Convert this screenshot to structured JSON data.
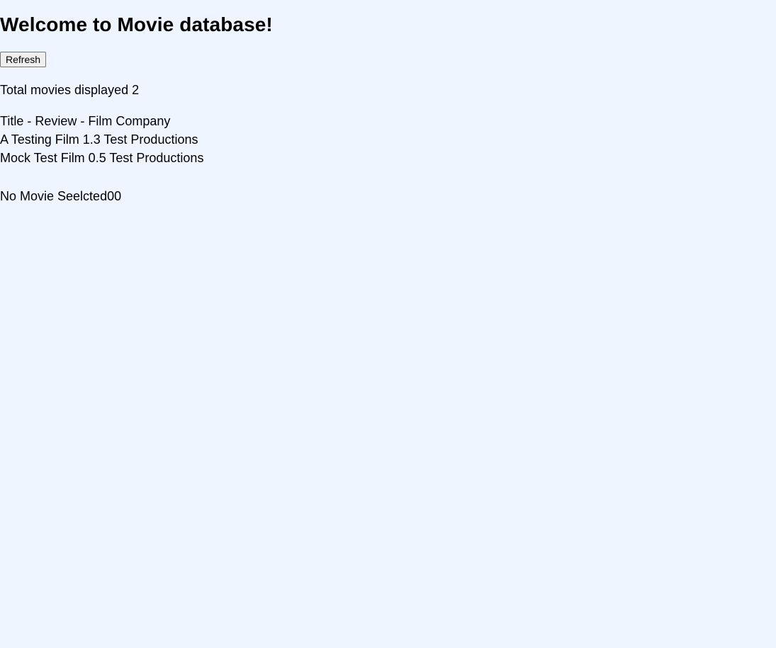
{
  "page": {
    "heading": "Welcome to Movie database!",
    "refresh_label": "Refresh",
    "total_text": "Total movies displayed 2",
    "list_header": "Title - Review - Film Company",
    "movies": [
      {
        "text": "A Testing Film 1.3 Test Productions"
      },
      {
        "text": "Mock Test Film 0.5 Test Productions"
      }
    ],
    "selected_text": "No Movie Seelcted00"
  },
  "colors": {
    "background": "#eef5ff",
    "text": "#000000",
    "button_bg": "#efefef",
    "button_border": "#767676"
  }
}
